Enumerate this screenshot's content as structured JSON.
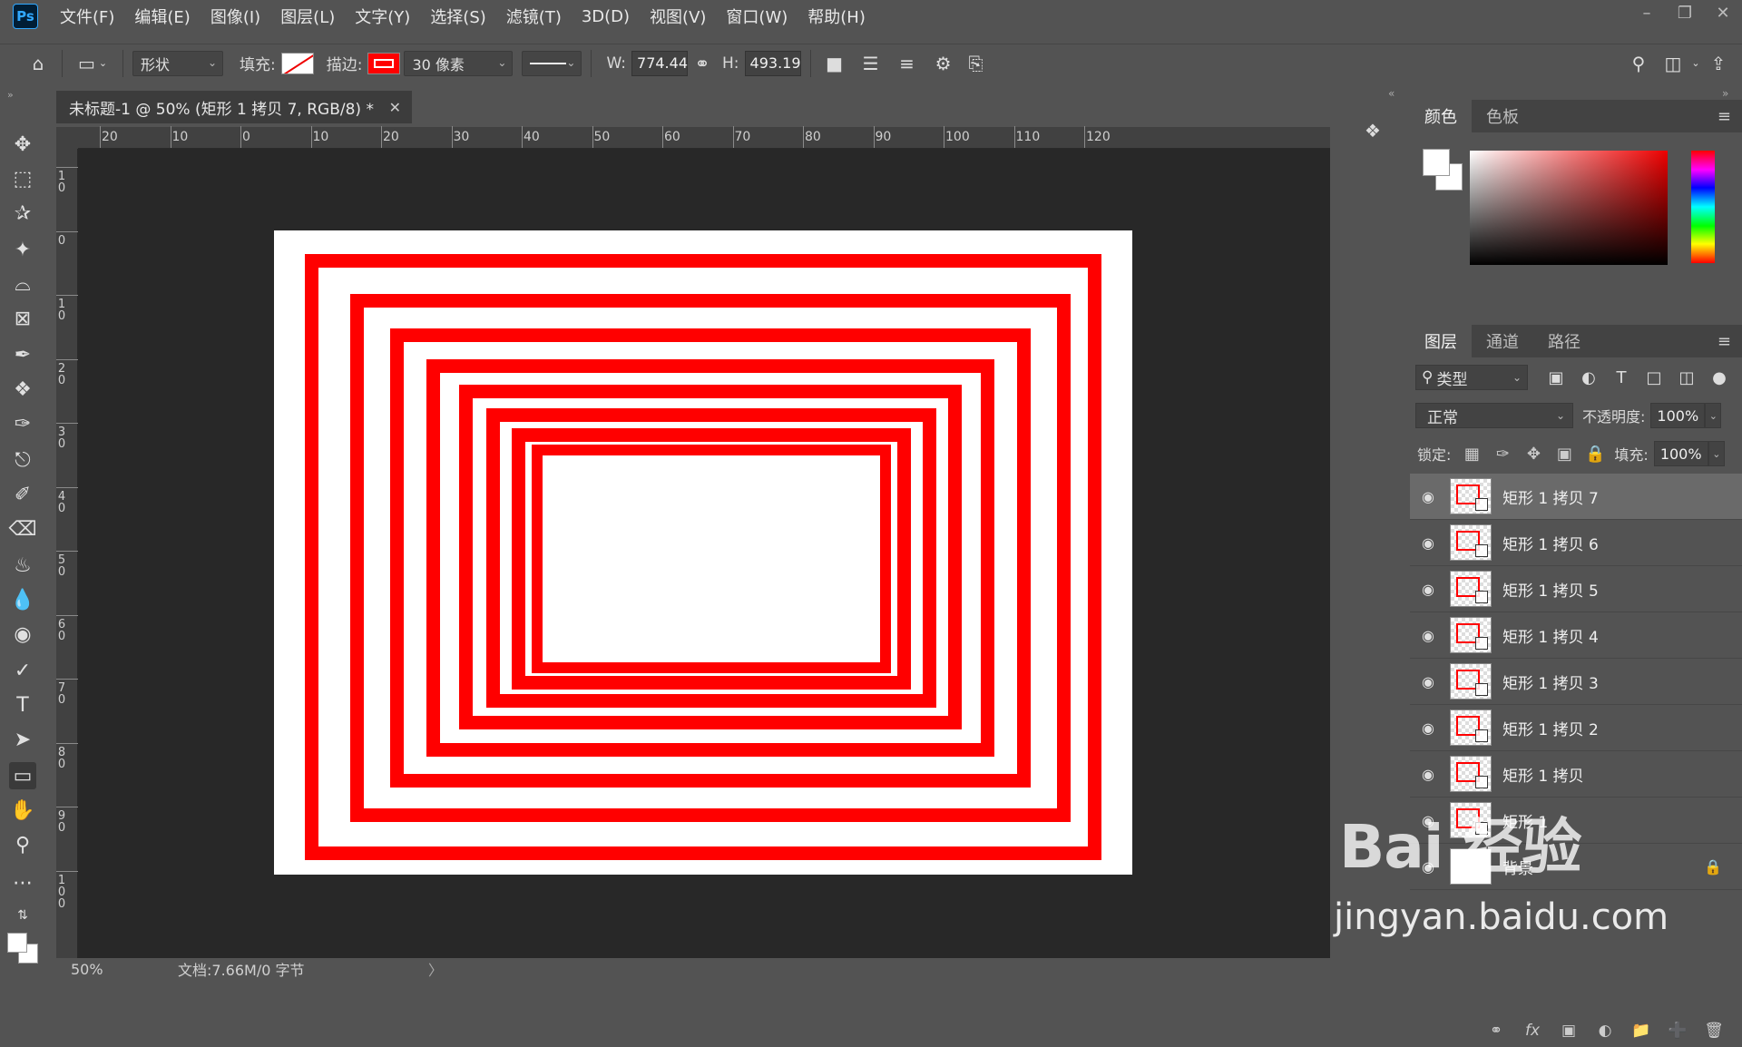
{
  "app": {
    "logo": "Ps"
  },
  "menu": [
    "文件(F)",
    "编辑(E)",
    "图像(I)",
    "图层(L)",
    "文字(Y)",
    "选择(S)",
    "滤镜(T)",
    "3D(D)",
    "视图(V)",
    "窗口(W)",
    "帮助(H)"
  ],
  "options": {
    "mode": "形状",
    "fill_label": "填充:",
    "stroke_label": "描边:",
    "stroke_width": "30 像素",
    "w_label": "W:",
    "w_value": "774.44",
    "h_label": "H:",
    "h_value": "493.19"
  },
  "document": {
    "tab_title": "未标题-1 @ 50% (矩形 1 拷贝 7, RGB/8) *",
    "ruler_h": [
      "20",
      "10",
      "0",
      "10",
      "20",
      "30",
      "40",
      "50",
      "60",
      "70",
      "80",
      "90",
      "100",
      "110",
      "120"
    ],
    "ruler_v": [
      "1\n0",
      "0",
      "1\n0",
      "2\n0",
      "3\n0",
      "4\n0",
      "5\n0",
      "6\n0",
      "7\n0",
      "8\n0",
      "9\n0",
      "1\n0\n0"
    ]
  },
  "status": {
    "zoom": "50%",
    "doc_info": "文档:7.66M/0 字节",
    "arrow": "〉"
  },
  "panels": {
    "color_tabs": [
      "颜色",
      "色板"
    ],
    "layers_tabs": [
      "图层",
      "通道",
      "路径"
    ],
    "filter_kind": "类型",
    "blend_mode": "正常",
    "opacity_label": "不透明度:",
    "opacity_value": "100%",
    "lock_label": "锁定:",
    "fill_label": "填充:",
    "fill_value": "100%"
  },
  "layers": [
    {
      "name": "矩形 1 拷贝 7",
      "selected": true
    },
    {
      "name": "矩形 1 拷贝 6"
    },
    {
      "name": "矩形 1 拷贝 5"
    },
    {
      "name": "矩形 1 拷贝 4"
    },
    {
      "name": "矩形 1 拷贝 3"
    },
    {
      "name": "矩形 1 拷贝 2"
    },
    {
      "name": "矩形 1 拷贝"
    },
    {
      "name": "矩形 1"
    },
    {
      "name": "背景",
      "locked": true
    }
  ],
  "colors": {
    "stroke": "#ff0000",
    "canvas_bg": "#282828",
    "ui_bg": "#535353"
  },
  "watermark": {
    "main": "Bai 经验",
    "sub": "jingyan.baidu.com"
  }
}
